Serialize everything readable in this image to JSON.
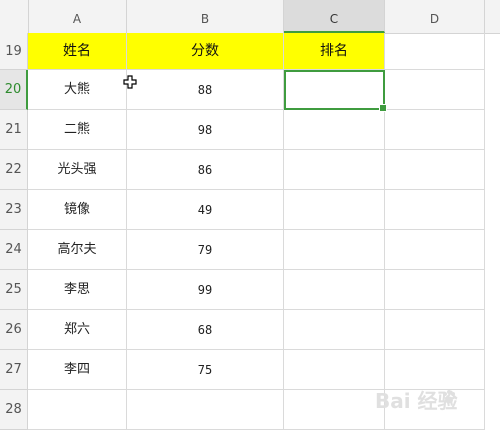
{
  "columns": [
    "A",
    "B",
    "C",
    "D"
  ],
  "active_column": "C",
  "rows": [
    "19",
    "20",
    "21",
    "22",
    "23",
    "24",
    "25",
    "26",
    "27",
    "28"
  ],
  "active_row": "20",
  "header": {
    "name": "姓名",
    "score": "分数",
    "rank": "排名"
  },
  "records": [
    {
      "name": "大熊",
      "score": "88"
    },
    {
      "name": "二熊",
      "score": "98"
    },
    {
      "name": "光头强",
      "score": "86"
    },
    {
      "name": "镜像",
      "score": "49"
    },
    {
      "name": "高尔夫",
      "score": "79"
    },
    {
      "name": "李思",
      "score": "99"
    },
    {
      "name": "郑六",
      "score": "68"
    },
    {
      "name": "李四",
      "score": "75"
    }
  ],
  "selected_cell": "C20",
  "colors": {
    "header_fill": "#ffff00",
    "selection": "#3f9c3f"
  },
  "watermark": {
    "text": "Bai 经验",
    "icon": "baidu-paw-icon"
  }
}
